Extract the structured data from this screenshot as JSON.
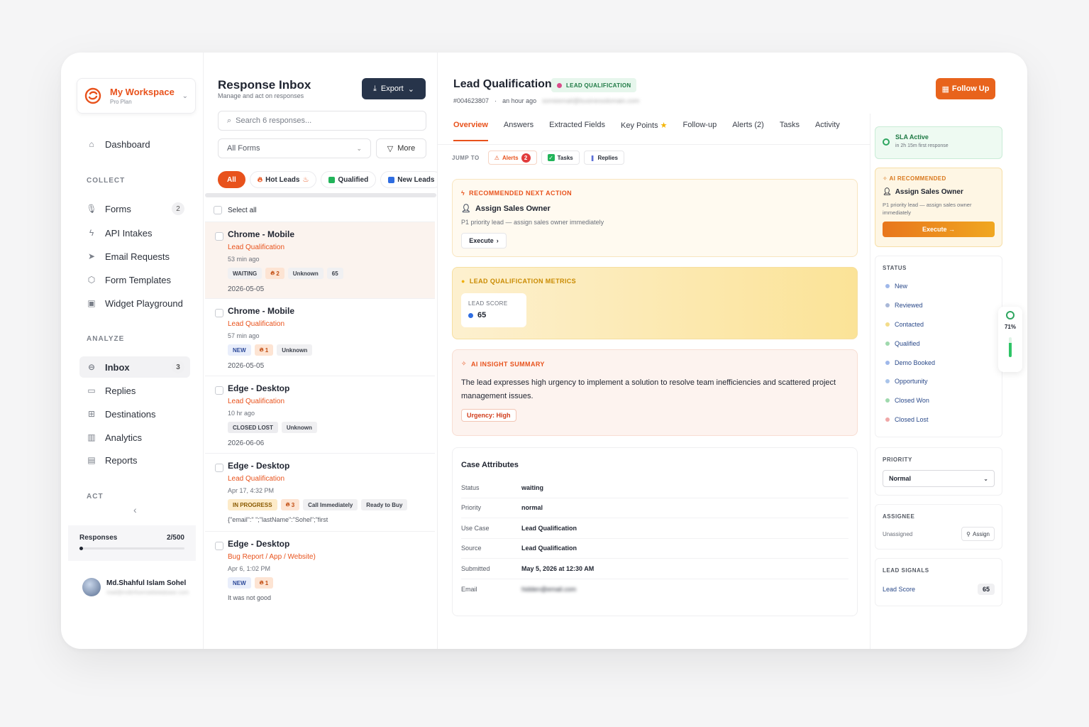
{
  "workspace": {
    "name": "My Workspace",
    "plan": "Pro Plan"
  },
  "sidebar": {
    "dashboard": "Dashboard",
    "sections": {
      "collect": "COLLECT",
      "analyze": "ANALYZE",
      "act": "ACT"
    },
    "collect_items": [
      {
        "label": "Forms",
        "count": "2",
        "icon": "mic-icon"
      },
      {
        "label": "API Intakes",
        "count": "",
        "icon": "bolt-icon"
      },
      {
        "label": "Email Requests",
        "count": "",
        "icon": "send-icon"
      },
      {
        "label": "Form Templates",
        "count": "",
        "icon": "cube-icon"
      },
      {
        "label": "Widget Playground",
        "count": "",
        "icon": "widget-icon"
      }
    ],
    "analyze_items": [
      {
        "label": "Inbox",
        "count": "3",
        "icon": "inbox-icon",
        "active": true
      },
      {
        "label": "Replies",
        "count": "",
        "icon": "chat-icon"
      },
      {
        "label": "Destinations",
        "count": "",
        "icon": "grid-icon"
      },
      {
        "label": "Analytics",
        "count": "",
        "icon": "bar-chart-icon"
      },
      {
        "label": "Reports",
        "count": "",
        "icon": "report-icon"
      }
    ],
    "usage": {
      "label": "Responses",
      "value": "2/500",
      "fraction": 0.004
    },
    "user": {
      "name": "Md.Shahful Islam Sohel",
      "email": "mail@mdinfoemaildatabase.com"
    }
  },
  "inbox": {
    "title": "Response Inbox",
    "subtitle": "Manage and act on responses",
    "export_label": "Export",
    "search_placeholder": "Search 6 responses...",
    "forms_filter": "All Forms",
    "more_label": "More",
    "chips": [
      {
        "label": "All",
        "active": true
      },
      {
        "label": "Hot Leads",
        "icon": "fire-icon"
      },
      {
        "label": "Qualified",
        "icon": "check-square-icon"
      },
      {
        "label": "New Leads",
        "icon": "blue-square-icon"
      }
    ],
    "select_all": "Select all",
    "items": [
      {
        "title": "Chrome - Mobile",
        "form": "Lead Qualification",
        "time": "53 min ago",
        "tags": [
          {
            "t": "WAITING",
            "k": "plain"
          },
          {
            "t": "2",
            "k": "fire"
          },
          {
            "t": "Unknown",
            "k": "plain"
          },
          {
            "t": "65",
            "k": "plain"
          }
        ],
        "date": "2026-05-05",
        "snippet": "",
        "selected": true
      },
      {
        "title": "Chrome - Mobile",
        "form": "Lead Qualification",
        "time": "57 min ago",
        "tags": [
          {
            "t": "NEW",
            "k": "new"
          },
          {
            "t": "1",
            "k": "fire"
          },
          {
            "t": "Unknown",
            "k": "plain"
          }
        ],
        "date": "2026-05-05",
        "snippet": ""
      },
      {
        "title": "Edge - Desktop",
        "form": "Lead Qualification",
        "time": "10 hr ago",
        "tags": [
          {
            "t": "CLOSED LOST",
            "k": "lost"
          },
          {
            "t": "Unknown",
            "k": "plain"
          }
        ],
        "date": "2026-06-06",
        "snippet": ""
      },
      {
        "title": "Edge - Desktop",
        "form": "Lead Qualification",
        "time": "Apr 17, 4:32 PM",
        "tags": [
          {
            "t": "IN PROGRESS",
            "k": "prog"
          },
          {
            "t": "3",
            "k": "fire"
          },
          {
            "t": "Call Immediately",
            "k": "plain"
          },
          {
            "t": "Ready to Buy",
            "k": "plain"
          }
        ],
        "date": "",
        "snippet": "{\"email\":\"                \";\"lastName\":\"Sohel\";\"first"
      },
      {
        "title": "Edge - Desktop",
        "form": "Bug Report / App / Website)",
        "time": "Apr 6, 1:02 PM",
        "tags": [
          {
            "t": "NEW",
            "k": "new"
          },
          {
            "t": "1",
            "k": "fire"
          }
        ],
        "date": "",
        "snippet": "It was not good"
      }
    ]
  },
  "detail": {
    "title": "Lead Qualification",
    "badge": "LEAD QUALIFICATION",
    "id": "#004623807",
    "time": "an hour ago",
    "email_blur": "someemail@businessdomain.com",
    "follow_up": "Follow Up",
    "tabs": [
      "Overview",
      "Answers",
      "Extracted Fields",
      "Key Points",
      "Follow-up",
      "Alerts (2)",
      "Tasks",
      "Activity"
    ],
    "jump": {
      "label": "JUMP TO",
      "alerts": "Alerts",
      "alerts_count": "2",
      "tasks": "Tasks",
      "replies": "Replies"
    },
    "recommended": {
      "label": "RECOMMENDED NEXT ACTION",
      "action": "Assign Sales Owner",
      "desc": "P1 priority lead — assign sales owner immediately",
      "execute": "Execute"
    },
    "metrics": {
      "label": "LEAD QUALIFICATION METRICS",
      "score_label": "LEAD SCORE",
      "score": "65"
    },
    "insight": {
      "label": "AI INSIGHT SUMMARY",
      "text": "The lead expresses high urgency to implement a solution to resolve team inefficiencies and scattered project management issues.",
      "urgency": "Urgency: High"
    },
    "attributes": {
      "title": "Case Attributes",
      "rows": [
        {
          "k": "Status",
          "v": "waiting"
        },
        {
          "k": "Priority",
          "v": "normal"
        },
        {
          "k": "Use Case",
          "v": "Lead Qualification"
        },
        {
          "k": "Source",
          "v": "Lead Qualification"
        },
        {
          "k": "Submitted",
          "v": "May 5, 2026 at 12:30 AM"
        },
        {
          "k": "Email",
          "v": "hidden@email.com",
          "blur": true
        }
      ]
    }
  },
  "right": {
    "sla": {
      "title": "SLA Active",
      "sub": "in 2h 15m first response"
    },
    "ai": {
      "label": "AI RECOMMENDED",
      "action": "Assign Sales Owner",
      "desc": "P1 priority lead — assign sales owner immediately",
      "execute": "Execute →"
    },
    "status": {
      "label": "STATUS",
      "items": [
        {
          "t": "New",
          "c": "#9fb8ea"
        },
        {
          "t": "Reviewed",
          "c": "#a9b8d8"
        },
        {
          "t": "Contacted",
          "c": "#f3dc8a"
        },
        {
          "t": "Qualified",
          "c": "#9fd9ad"
        },
        {
          "t": "Demo Booked",
          "c": "#9fb8ea"
        },
        {
          "t": "Opportunity",
          "c": "#a9c4ea"
        },
        {
          "t": "Closed Won",
          "c": "#9fd9ad"
        },
        {
          "t": "Closed Lost",
          "c": "#f0a7a7"
        }
      ]
    },
    "priority": {
      "label": "PRIORITY",
      "value": "Normal"
    },
    "assignee": {
      "label": "ASSIGNEE",
      "value": "Unassigned",
      "button": "Assign"
    },
    "signals": {
      "label": "LEAD SIGNALS",
      "k": "Lead Score",
      "v": "65"
    },
    "progress": {
      "value": "71%",
      "fraction": 0.71
    }
  },
  "colors": {
    "accent": "#e8521c",
    "dark_button": "#27344a",
    "success": "#2ea660"
  }
}
